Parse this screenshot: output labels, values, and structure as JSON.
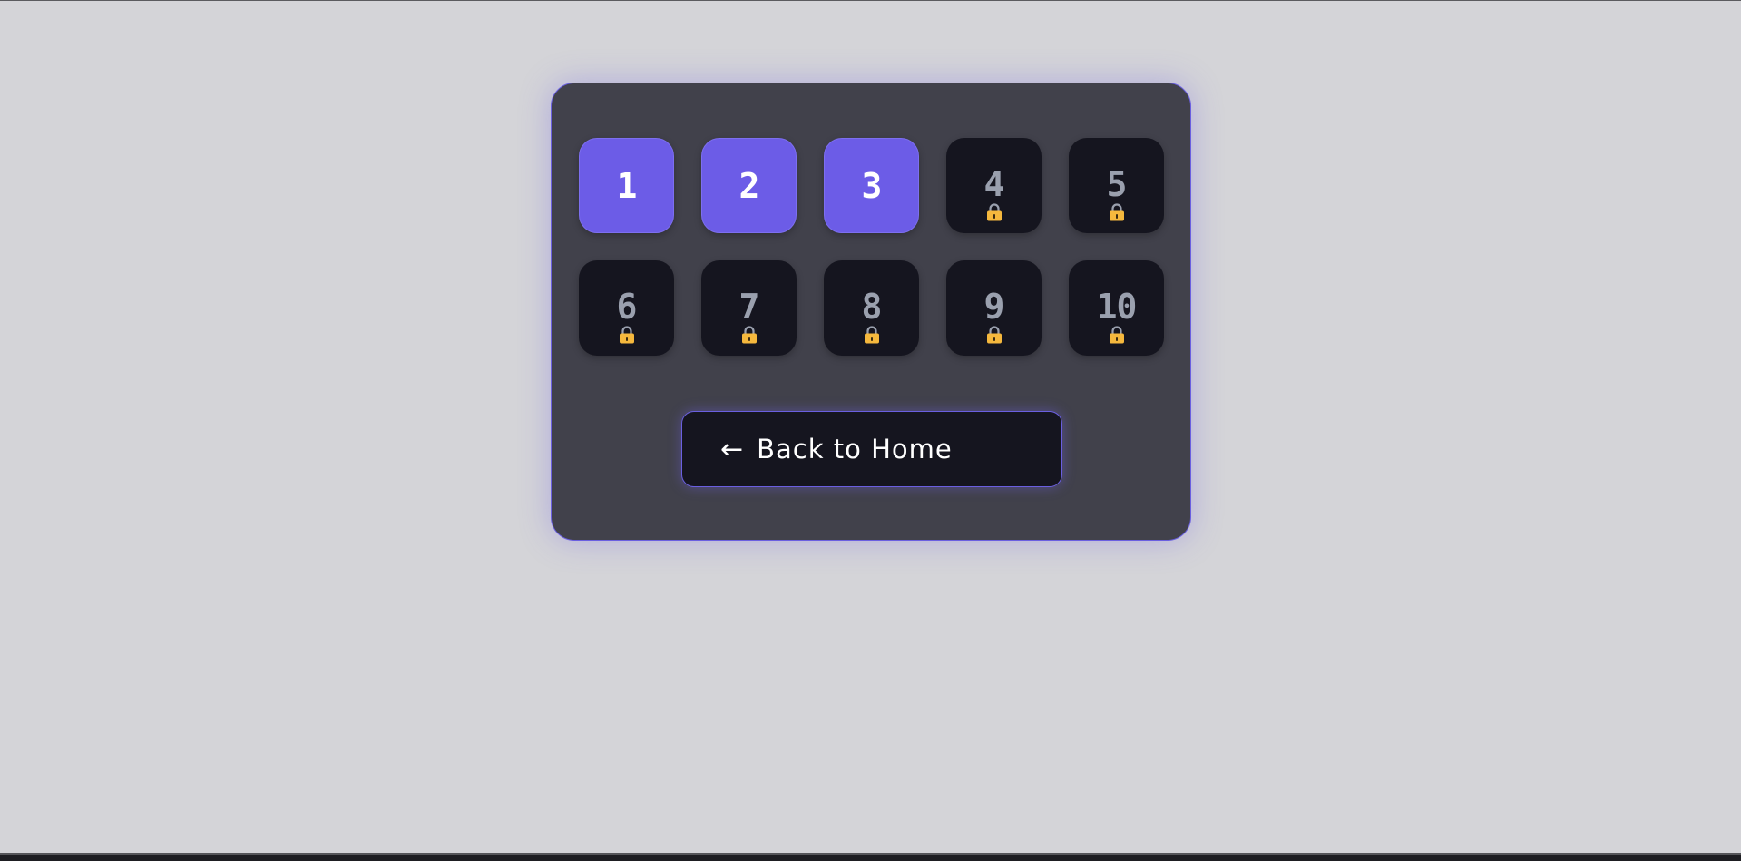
{
  "levels": [
    {
      "label": "1",
      "locked": false
    },
    {
      "label": "2",
      "locked": false
    },
    {
      "label": "3",
      "locked": false
    },
    {
      "label": "4",
      "locked": true
    },
    {
      "label": "5",
      "locked": true
    },
    {
      "label": "6",
      "locked": true
    },
    {
      "label": "7",
      "locked": true
    },
    {
      "label": "8",
      "locked": true
    },
    {
      "label": "9",
      "locked": true
    },
    {
      "label": "10",
      "locked": true
    }
  ],
  "back_button": {
    "arrow": "←",
    "label": "Back to Home"
  },
  "colors": {
    "page_background": "#d4d4d8",
    "panel_background": "#41414b",
    "accent": "#6c5ce7",
    "locked_tile": "#15151f",
    "lock_icon": "#f5b83d"
  },
  "icons": {
    "lock": "lock-icon"
  }
}
